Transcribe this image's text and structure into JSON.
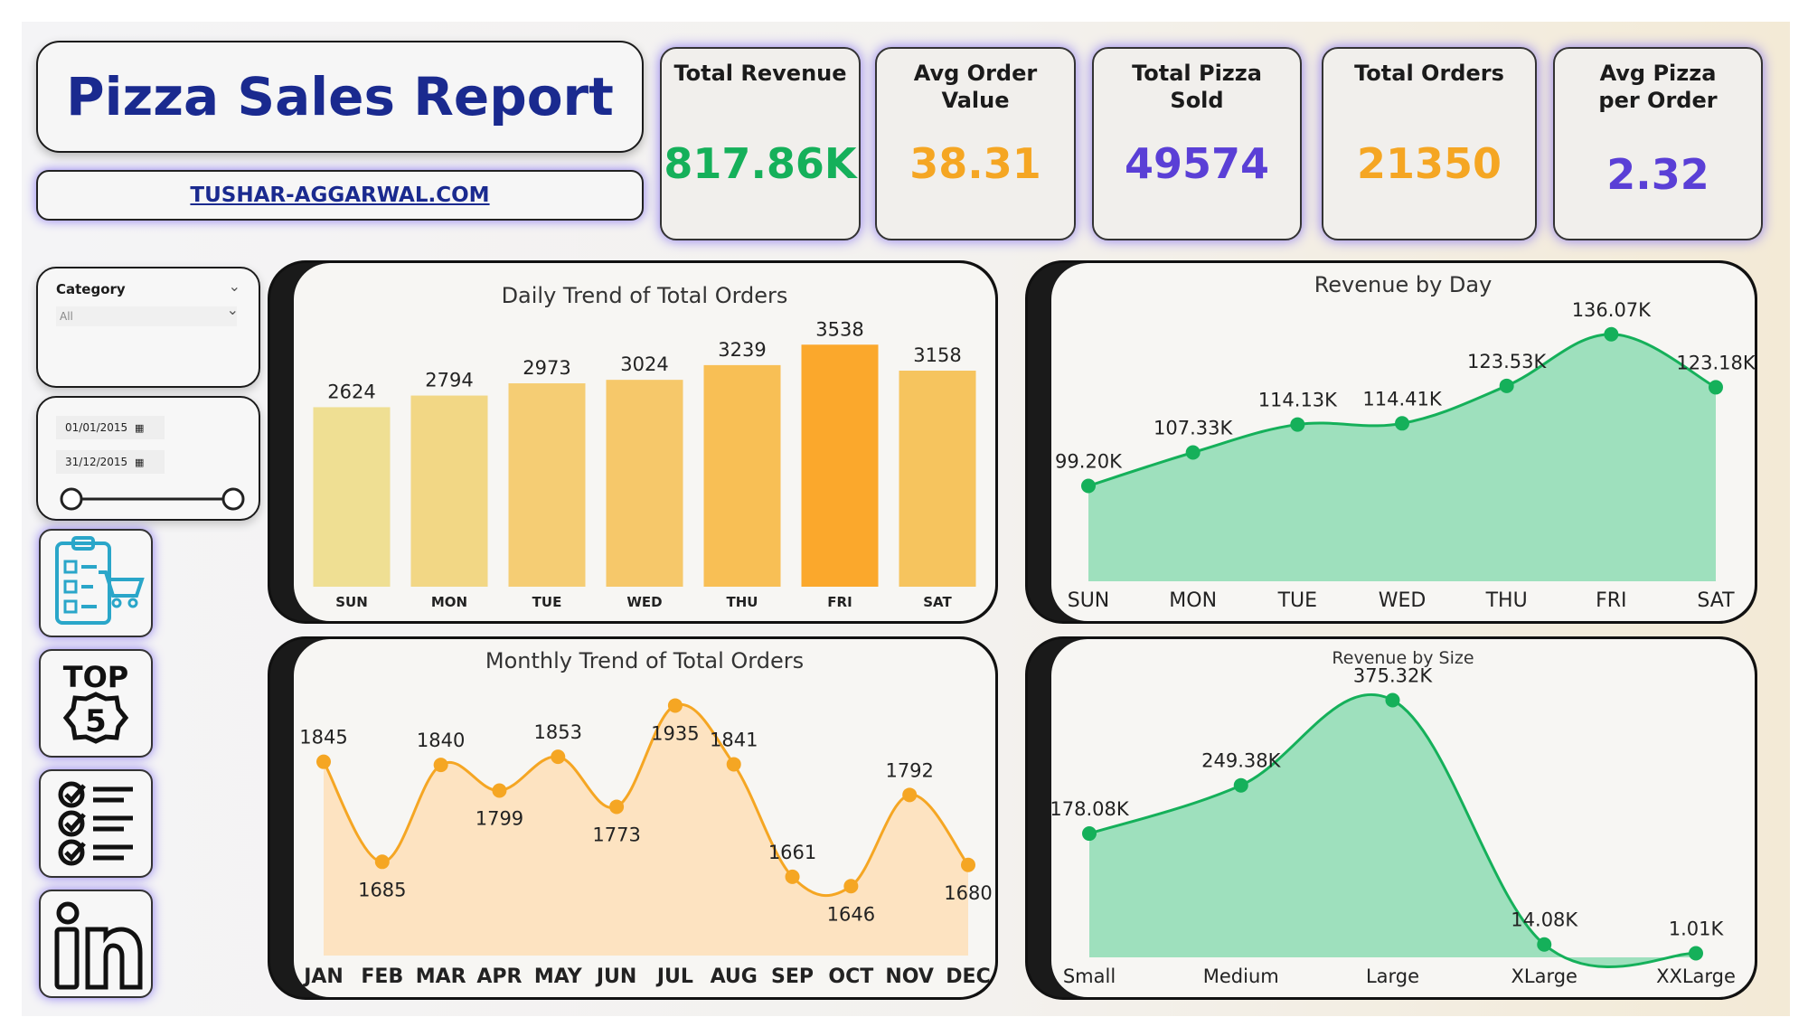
{
  "header": {
    "title": "Pizza Sales Report",
    "url": "TUSHAR-AGGARWAL.COM"
  },
  "kpis": [
    {
      "label": "Total Revenue",
      "value": "817.86K",
      "color": "#15b05a"
    },
    {
      "label": "Avg Order Value",
      "value": "38.31",
      "color": "#f5a623"
    },
    {
      "label": "Total Pizza Sold",
      "value": "49574",
      "color": "#5a3fd6"
    },
    {
      "label": "Total Orders",
      "value": "21350",
      "color": "#f5a623"
    },
    {
      "label": "Avg Pizza per Order",
      "value": "2.32",
      "color": "#5a3fd6"
    }
  ],
  "filters": {
    "category_label": "Category",
    "category_value": "All",
    "date_start": "01/01/2015",
    "date_end": "31/12/2015"
  },
  "nav_icons": [
    "checklist-cart-icon",
    "top5-icon",
    "checklist-icon",
    "linkedin-icon"
  ],
  "nav_text": {
    "top": "TOP",
    "five": "5"
  },
  "chart_data": [
    {
      "id": "daily",
      "type": "bar",
      "title": "Daily Trend of Total Orders",
      "categories": [
        "SUN",
        "MON",
        "TUE",
        "WED",
        "THU",
        "FRI",
        "SAT"
      ],
      "values": [
        2624,
        2794,
        2973,
        3024,
        3239,
        3538,
        3158
      ],
      "labels": [
        "2624",
        "2794",
        "2973",
        "3024",
        "3239",
        "3538",
        "3158"
      ],
      "colors": [
        "#efdf93",
        "#f2d785",
        "#f5cd74",
        "#f6c86a",
        "#f8bf55",
        "#fba82c",
        "#f6c45e"
      ],
      "ylim": [
        0,
        3700
      ]
    },
    {
      "id": "revenue_day",
      "type": "area",
      "title": "Revenue by Day",
      "categories": [
        "SUN",
        "MON",
        "TUE",
        "WED",
        "THU",
        "FRI",
        "SAT"
      ],
      "values": [
        99.2,
        107.33,
        114.13,
        114.41,
        123.53,
        136.07,
        123.18
      ],
      "labels": [
        "99.20K",
        "107.33K",
        "114.13K",
        "114.41K",
        "123.53K",
        "136.07K",
        "123.18K"
      ],
      "color": "#15b05a",
      "fill": "#9ee0bd",
      "ylim": [
        76,
        138
      ]
    },
    {
      "id": "monthly",
      "type": "area",
      "title": "Monthly Trend of Total Orders",
      "categories": [
        "JAN",
        "FEB",
        "MAR",
        "APR",
        "MAY",
        "JUN",
        "JUL",
        "AUG",
        "SEP",
        "OCT",
        "NOV",
        "DEC"
      ],
      "values": [
        1845,
        1685,
        1840,
        1799,
        1853,
        1773,
        1935,
        1841,
        1661,
        1646,
        1792,
        1680
      ],
      "labels": [
        "1845",
        "1685",
        "1840",
        "1799",
        "1853",
        "1773",
        "1935",
        "1841",
        "1661",
        "1646",
        "1792",
        "1680"
      ],
      "color": "#f5a623",
      "fill": "#fde3c1",
      "ylim": [
        1535,
        1940
      ]
    },
    {
      "id": "revenue_size",
      "type": "area",
      "title": "Revenue by Size",
      "categories": [
        "Small",
        "Medium",
        "Large",
        "XLarge",
        "XXLarge"
      ],
      "values": [
        178.08,
        249.38,
        375.32,
        14.08,
        1.01
      ],
      "labels": [
        "178.08K",
        "249.38K",
        "375.32K",
        "14.08K",
        "1.01K"
      ],
      "color": "#15b05a",
      "fill": "#9ee0bd",
      "ylim": [
        -5,
        380
      ]
    }
  ]
}
